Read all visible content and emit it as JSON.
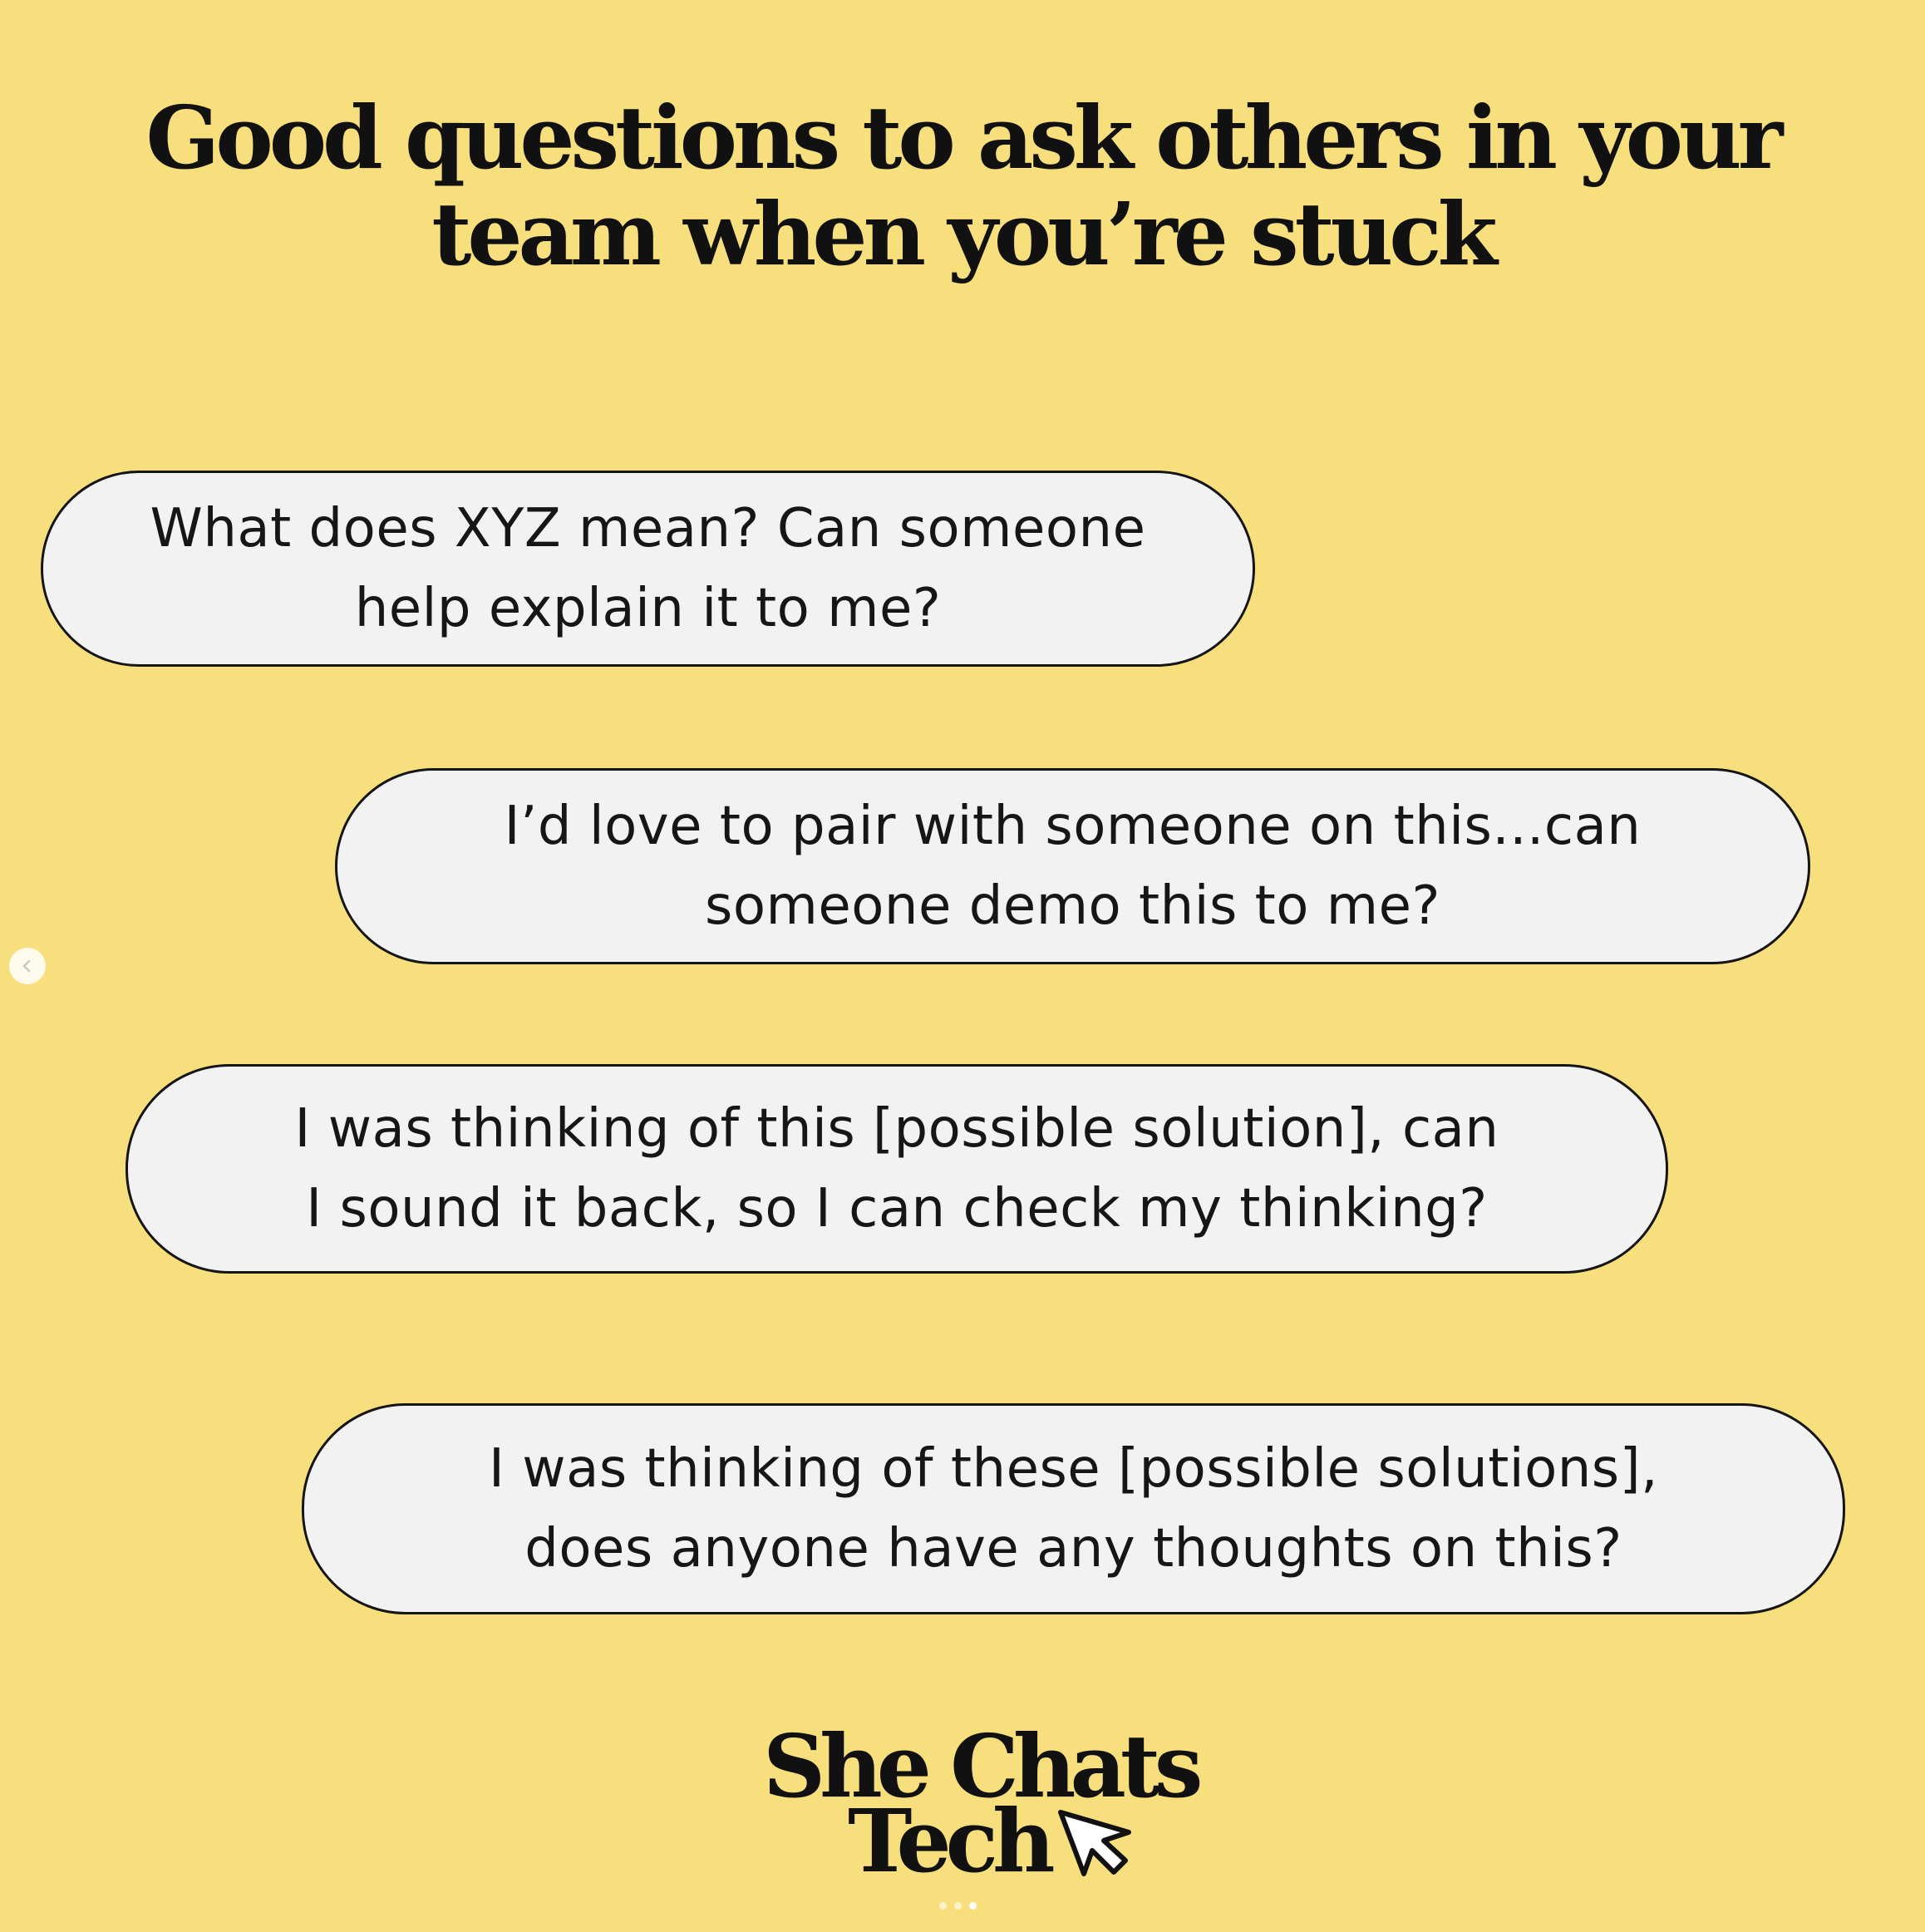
{
  "title": {
    "line1": "Good questions to ask others in your",
    "line2": "team when you’re stuck"
  },
  "bubbles": [
    {
      "line1": "What does XYZ mean? Can someone",
      "line2": "help explain it to me?"
    },
    {
      "line1": "I’d love to pair with someone on this...can",
      "line2": "someone demo this to me?"
    },
    {
      "line1": "I was thinking of this [possible solution], can",
      "line2": "I sound it back, so I can check my thinking?"
    },
    {
      "line1": "I was thinking of these [possible solutions],",
      "line2": "does anyone have any thoughts on this?"
    }
  ],
  "logo": {
    "line1": "She Chats",
    "line2": "Tech"
  },
  "icons": {
    "prev": "chevron-left-icon",
    "logo_cursor": "cursor-arrow-icon"
  },
  "carousel": {
    "count": 3,
    "active_index": 2
  },
  "colors": {
    "background": "#f8df7d",
    "bubble": "#f2f2f2",
    "text": "#111111"
  }
}
